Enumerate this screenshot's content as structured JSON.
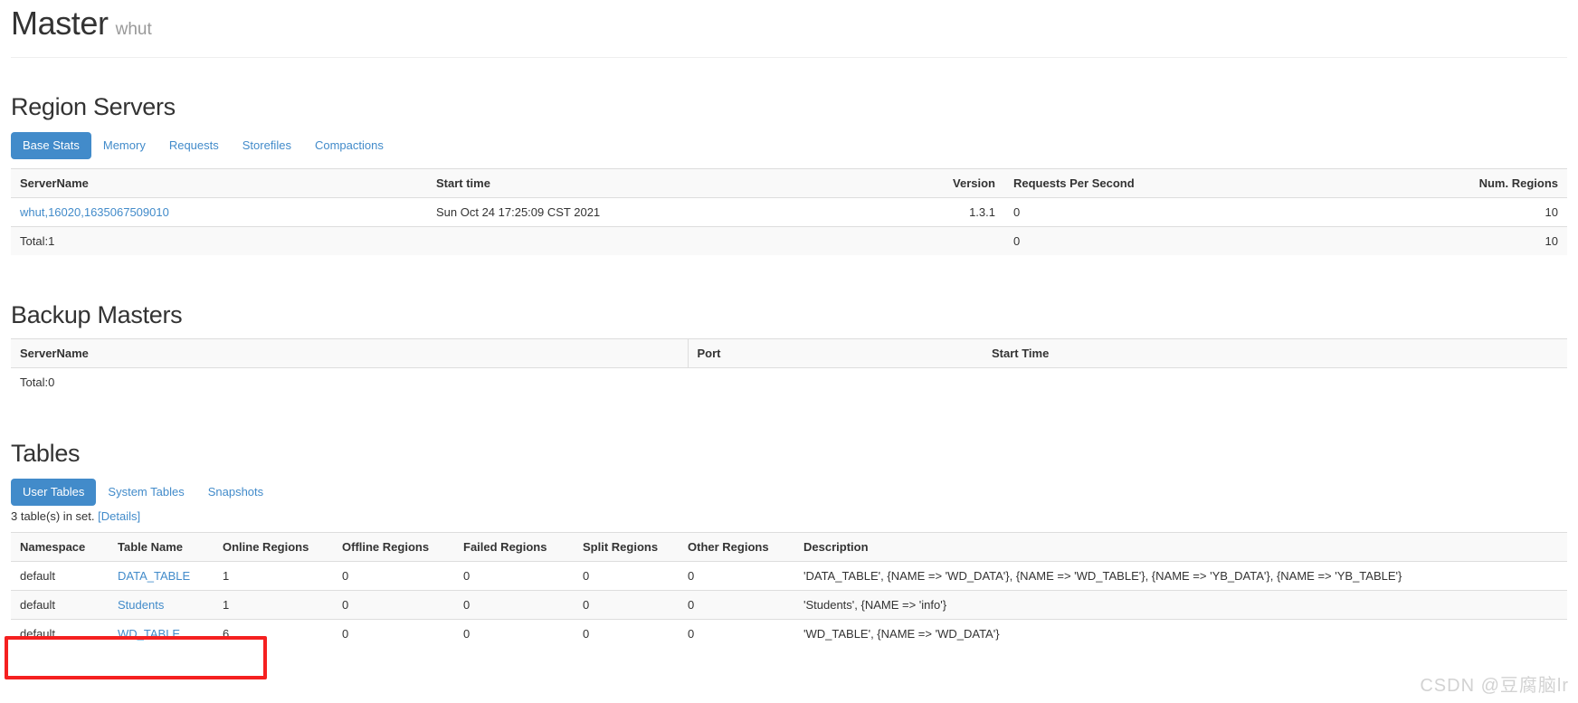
{
  "header": {
    "title": "Master",
    "subtitle": "whut"
  },
  "region_servers": {
    "title": "Region Servers",
    "tabs": [
      {
        "label": "Base Stats",
        "active": true
      },
      {
        "label": "Memory",
        "active": false
      },
      {
        "label": "Requests",
        "active": false
      },
      {
        "label": "Storefiles",
        "active": false
      },
      {
        "label": "Compactions",
        "active": false
      }
    ],
    "columns": [
      "ServerName",
      "Start time",
      "Version",
      "Requests Per Second",
      "Num. Regions"
    ],
    "rows": [
      {
        "server_name": "whut,16020,1635067509010",
        "start_time": "Sun Oct 24 17:25:09 CST 2021",
        "version": "1.3.1",
        "requests_per_second": "0",
        "num_regions": "10"
      }
    ],
    "total_label": "Total:1",
    "total_requests_per_second": "0",
    "total_num_regions": "10"
  },
  "backup_masters": {
    "title": "Backup Masters",
    "columns": [
      "ServerName",
      "Port",
      "Start Time"
    ],
    "rows": [],
    "total_label": "Total:0"
  },
  "tables": {
    "title": "Tables",
    "tabs": [
      {
        "label": "User Tables",
        "active": true
      },
      {
        "label": "System Tables",
        "active": false
      },
      {
        "label": "Snapshots",
        "active": false
      }
    ],
    "count_text": "3 table(s) in set.",
    "details_label": "[Details]",
    "columns": [
      "Namespace",
      "Table Name",
      "Online Regions",
      "Offline Regions",
      "Failed Regions",
      "Split Regions",
      "Other Regions",
      "Description"
    ],
    "rows": [
      {
        "namespace": "default",
        "table_name": "DATA_TABLE",
        "online_regions": "1",
        "offline_regions": "0",
        "failed_regions": "0",
        "split_regions": "0",
        "other_regions": "0",
        "description": "'DATA_TABLE', {NAME => 'WD_DATA'}, {NAME => 'WD_TABLE'}, {NAME => 'YB_DATA'}, {NAME => 'YB_TABLE'}"
      },
      {
        "namespace": "default",
        "table_name": "Students",
        "online_regions": "1",
        "offline_regions": "0",
        "failed_regions": "0",
        "split_regions": "0",
        "other_regions": "0",
        "description": "'Students', {NAME => 'info'}"
      },
      {
        "namespace": "default",
        "table_name": "WD_TABLE",
        "online_regions": "6",
        "offline_regions": "0",
        "failed_regions": "0",
        "split_regions": "0",
        "other_regions": "0",
        "description": "'WD_TABLE', {NAME => 'WD_DATA'}"
      }
    ]
  },
  "annotation": {
    "color": "#f52020"
  },
  "watermark": {
    "text": "CSDN @豆腐脑lr",
    "color": "#d2d2d2"
  }
}
